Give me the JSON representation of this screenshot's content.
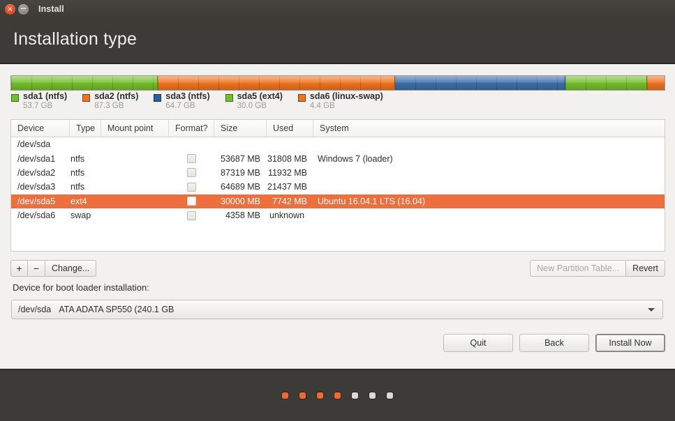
{
  "window": {
    "title": "Install",
    "close_icon": "close-icon",
    "minimize_icon": "minimize-icon",
    "close_glyph": "×",
    "minimize_glyph": "−"
  },
  "header": {
    "page_title": "Installation type"
  },
  "partition_bar": {
    "segments": [
      {
        "name": "sda1",
        "color": "#74bf2c",
        "percent": 22.4
      },
      {
        "name": "sda2",
        "color": "#ef7420",
        "percent": 36.4
      },
      {
        "name": "sda3",
        "color": "#3b6fa8",
        "percent": 26.0
      },
      {
        "name": "sda5",
        "color": "#74bf2c",
        "percent": 12.5
      },
      {
        "name": "sda6",
        "color": "#ef7420",
        "percent": 2.7
      }
    ]
  },
  "legend": [
    {
      "label": "sda1 (ntfs)",
      "size": "53.7 GB",
      "color": "#74bf2c"
    },
    {
      "label": "sda2 (ntfs)",
      "size": "87.3 GB",
      "color": "#ef7420"
    },
    {
      "label": "sda3 (ntfs)",
      "size": "64.7 GB",
      "color": "#2b5f9e"
    },
    {
      "label": "sda5 (ext4)",
      "size": "30.0 GB",
      "color": "#74bf2c"
    },
    {
      "label": "sda6 (linux-swap)",
      "size": "4.4 GB",
      "color": "#ef7420"
    }
  ],
  "table": {
    "columns": [
      "Device",
      "Type",
      "Mount point",
      "Format?",
      "Size",
      "Used",
      "System"
    ],
    "disk_row": "/dev/sda",
    "rows": [
      {
        "device": "/dev/sda1",
        "type": "ntfs",
        "mount": "",
        "format_checked": false,
        "size": "53687 MB",
        "used": "31808 MB",
        "system": "Windows 7 (loader)",
        "selected": false
      },
      {
        "device": "/dev/sda2",
        "type": "ntfs",
        "mount": "",
        "format_checked": false,
        "size": "87319 MB",
        "used": "11932 MB",
        "system": "",
        "selected": false
      },
      {
        "device": "/dev/sda3",
        "type": "ntfs",
        "mount": "",
        "format_checked": false,
        "size": "64689 MB",
        "used": "21437 MB",
        "system": "",
        "selected": false
      },
      {
        "device": "/dev/sda5",
        "type": "ext4",
        "mount": "",
        "format_checked": false,
        "size": "30000 MB",
        "used": "7742 MB",
        "system": "Ubuntu 16.04.1 LTS (16.04)",
        "selected": true
      },
      {
        "device": "/dev/sda6",
        "type": "swap",
        "mount": "",
        "format_checked": false,
        "size": "4358 MB",
        "used": "unknown",
        "system": "",
        "selected": false
      }
    ],
    "selected_row_color": "#ee6f3e"
  },
  "partition_toolbar": {
    "add_label": "+",
    "remove_label": "−",
    "change_label": "Change...",
    "new_table_label": "New Partition Table...",
    "new_table_enabled": false,
    "revert_label": "Revert",
    "revert_enabled": true
  },
  "bootloader": {
    "label": "Device for boot loader installation:",
    "device": "/dev/sda",
    "description": "ATA ADATA SP550 (240.1 GB"
  },
  "actions": {
    "quit": "Quit",
    "back": "Back",
    "install_now": "Install Now"
  },
  "progress": {
    "total": 7,
    "completed": 4
  }
}
